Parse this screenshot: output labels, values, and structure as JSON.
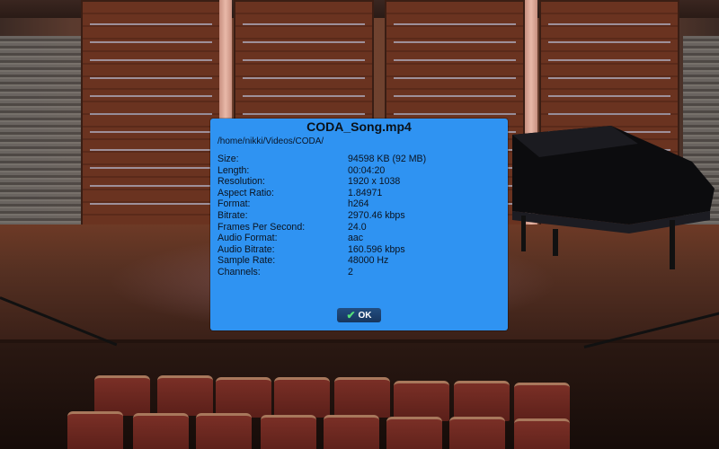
{
  "dialog": {
    "title": "CODA_Song.mp4",
    "path": "/home/nikki/Videos/CODA/",
    "properties": [
      {
        "label": "Size:",
        "value": "94598 KB (92 MB)"
      },
      {
        "label": "Length:",
        "value": "00:04:20"
      },
      {
        "label": "Resolution:",
        "value": "1920 x 1038"
      },
      {
        "label": "Aspect Ratio:",
        "value": "1.84971"
      },
      {
        "label": "Format:",
        "value": "h264"
      },
      {
        "label": "Bitrate:",
        "value": "2970.46 kbps"
      },
      {
        "label": "Frames Per Second:",
        "value": "24.0"
      },
      {
        "label": "Audio Format:",
        "value": "aac"
      },
      {
        "label": "Audio Bitrate:",
        "value": "160.596 kbps"
      },
      {
        "label": "Sample Rate:",
        "value": "48000 Hz"
      },
      {
        "label": "Channels:",
        "value": "2"
      }
    ],
    "ok_label": "OK",
    "ok_icon": "checkmark-icon"
  },
  "colors": {
    "dialog_bg": "#2f93f2",
    "ok_bg": "#1f4575",
    "check": "#55e07a"
  }
}
